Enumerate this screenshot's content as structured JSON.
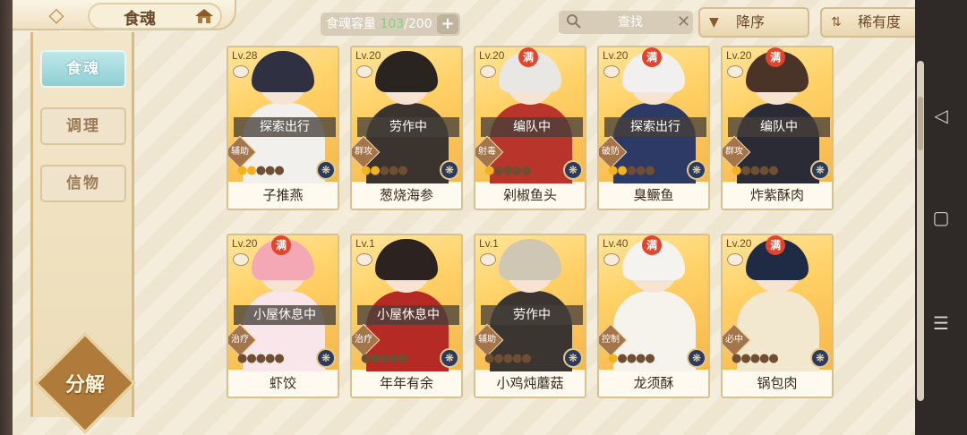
{
  "header": {
    "title": "食魂",
    "capacity_label": "食魂容量",
    "capacity_current": "103",
    "capacity_total": "/200",
    "capacity_add": "+",
    "search_placeholder": "查找",
    "clear_glyph": "✕",
    "sort_desc": "降序",
    "sort_rarity": "稀有度",
    "back_glyph": "◇",
    "sort_desc_glyph": "▼",
    "sort_rarity_glyph": "⇅"
  },
  "sidebar": {
    "tabs": [
      {
        "label": "食魂",
        "active": true
      },
      {
        "label": "调理",
        "active": false
      },
      {
        "label": "信物",
        "active": false
      }
    ],
    "decompose": "分解"
  },
  "system_nav": {
    "back": "◁",
    "home": "▢",
    "menu": "☰"
  },
  "max_badge": "满",
  "spirit_glyph": "❋",
  "cards": [
    {
      "level": "Lv.28",
      "max": false,
      "status": "探索出行",
      "role": "辅助",
      "stars_on": 2,
      "name": "子推燕",
      "hair": "#2f3142",
      "body": "#f2f0ec"
    },
    {
      "level": "Lv.20",
      "max": false,
      "status": "劳作中",
      "role": "群攻",
      "stars_on": 2,
      "name": "葱烧海参",
      "hair": "#2a2420",
      "body": "#3a332e"
    },
    {
      "level": "Lv.20",
      "max": true,
      "status": "编队中",
      "role": "射毒",
      "stars_on": 1,
      "name": "剁椒鱼头",
      "hair": "#e9e7e3",
      "body": "#b8352b"
    },
    {
      "level": "Lv.20",
      "max": true,
      "status": "探索出行",
      "role": "破防",
      "stars_on": 2,
      "name": "臭鳜鱼",
      "hair": "#f1f0ee",
      "body": "#2e3a66"
    },
    {
      "level": "Lv.20",
      "max": true,
      "status": "编队中",
      "role": "群攻",
      "stars_on": 1,
      "name": "炸紫酥肉",
      "hair": "#4a3428",
      "body": "#2b2b35"
    },
    {
      "level": "Lv.20",
      "max": true,
      "status": "小屋休息中",
      "role": "治疗",
      "stars_on": 0,
      "name": "虾饺",
      "hair": "#f4a7b4",
      "body": "#f9e6ea"
    },
    {
      "level": "Lv.1",
      "max": false,
      "status": "小屋休息中",
      "role": "治疗",
      "stars_on": 0,
      "name": "年年有余",
      "hair": "#2c2320",
      "body": "#b52a24"
    },
    {
      "level": "Lv.1",
      "max": false,
      "status": "劳作中",
      "role": "辅助",
      "stars_on": 0,
      "name": "小鸡炖蘑菇",
      "hair": "#cfc6b3",
      "body": "#3a3530"
    },
    {
      "level": "Lv.40",
      "max": true,
      "status": "",
      "role": "控制",
      "stars_on": 1,
      "name": "龙须酥",
      "hair": "#f4f3f0",
      "body": "#f6f3ec"
    },
    {
      "level": "Lv.20",
      "max": true,
      "status": "",
      "role": "必中",
      "stars_on": 0,
      "name": "锅包肉",
      "hair": "#1f2a44",
      "body": "#f2e7cf"
    }
  ]
}
